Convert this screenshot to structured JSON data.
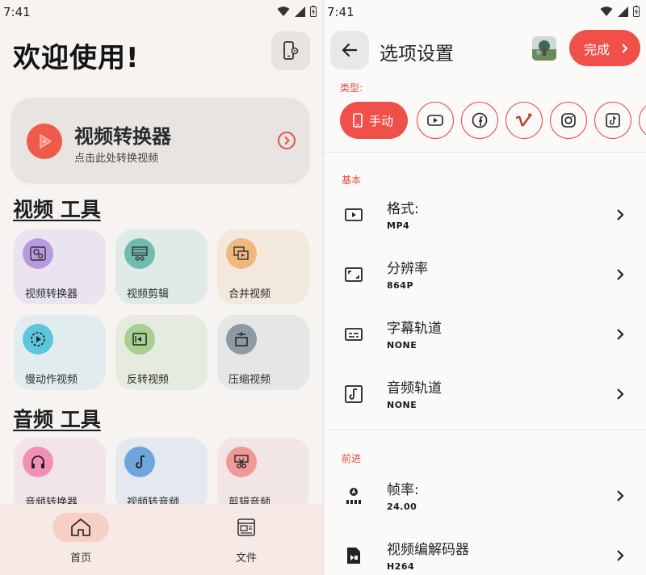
{
  "left": {
    "status_time": "7:41",
    "welcome": "欢迎使用!",
    "hero": {
      "title": "视频转换器",
      "subtitle": "点击此处转换视频"
    },
    "video_section": "视频 工具",
    "video_tools": [
      {
        "label": "视频转换器",
        "icon": "gear-video-icon",
        "bg": "#e9e4ef",
        "icon_bg": "#b79ae0"
      },
      {
        "label": "视频剪辑",
        "icon": "film-scissors-icon",
        "bg": "#e0eae7",
        "icon_bg": "#6fbcae"
      },
      {
        "label": "合并视频",
        "icon": "merge-video-icon",
        "bg": "#f3e8dc",
        "icon_bg": "#f0b77f"
      },
      {
        "label": "慢动作视频",
        "icon": "slow-motion-icon",
        "bg": "#e1ecef",
        "icon_bg": "#5dc6dc"
      },
      {
        "label": "反转视频",
        "icon": "reverse-video-icon",
        "bg": "#e6ebe0",
        "icon_bg": "#a6cf90"
      },
      {
        "label": "压缩视频",
        "icon": "compress-video-icon",
        "bg": "#e5e7e7",
        "icon_bg": "#8e9aa3"
      }
    ],
    "audio_section": "音频 工具",
    "audio_tools": [
      {
        "label": "音频转换器",
        "icon": "headphones-icon",
        "bg": "#f1e5e9",
        "icon_bg": "#f28fb6"
      },
      {
        "label": "视频转音频",
        "icon": "music-note-icon",
        "bg": "#e3e9ef",
        "icon_bg": "#6fa5dd"
      },
      {
        "label": "剪辑音频",
        "icon": "audio-cut-icon",
        "bg": "#f1e6e5",
        "icon_bg": "#ef9a98"
      }
    ],
    "nav": {
      "home": "首页",
      "files": "文件"
    }
  },
  "right": {
    "status_time": "7:41",
    "title": "选项设置",
    "done": "完成",
    "type_label": "类型:",
    "manual_chip": "手动",
    "type_chips": [
      "youtube-icon",
      "facebook-icon",
      "vimeo-icon",
      "instagram-icon",
      "tiktok-icon"
    ],
    "basic_label": "基本",
    "basic_rows": [
      {
        "title": "格式:",
        "value": "MP4",
        "icon": "video-format-icon"
      },
      {
        "title": "分辨率",
        "value": "864P",
        "icon": "resolution-icon"
      },
      {
        "title": "字幕轨道",
        "value": "NONE",
        "icon": "subtitles-icon"
      },
      {
        "title": "音频轨道",
        "value": "NONE",
        "icon": "audio-track-icon"
      }
    ],
    "advanced_label": "前进",
    "advanced_rows": [
      {
        "title": "帧率:",
        "value": "24.00",
        "icon": "frame-rate-icon"
      },
      {
        "title": "视频编解码器",
        "value": "H264",
        "icon": "video-codec-icon"
      }
    ]
  },
  "colors": {
    "accent": "#f0504a",
    "accent_text": "#e4493f"
  }
}
